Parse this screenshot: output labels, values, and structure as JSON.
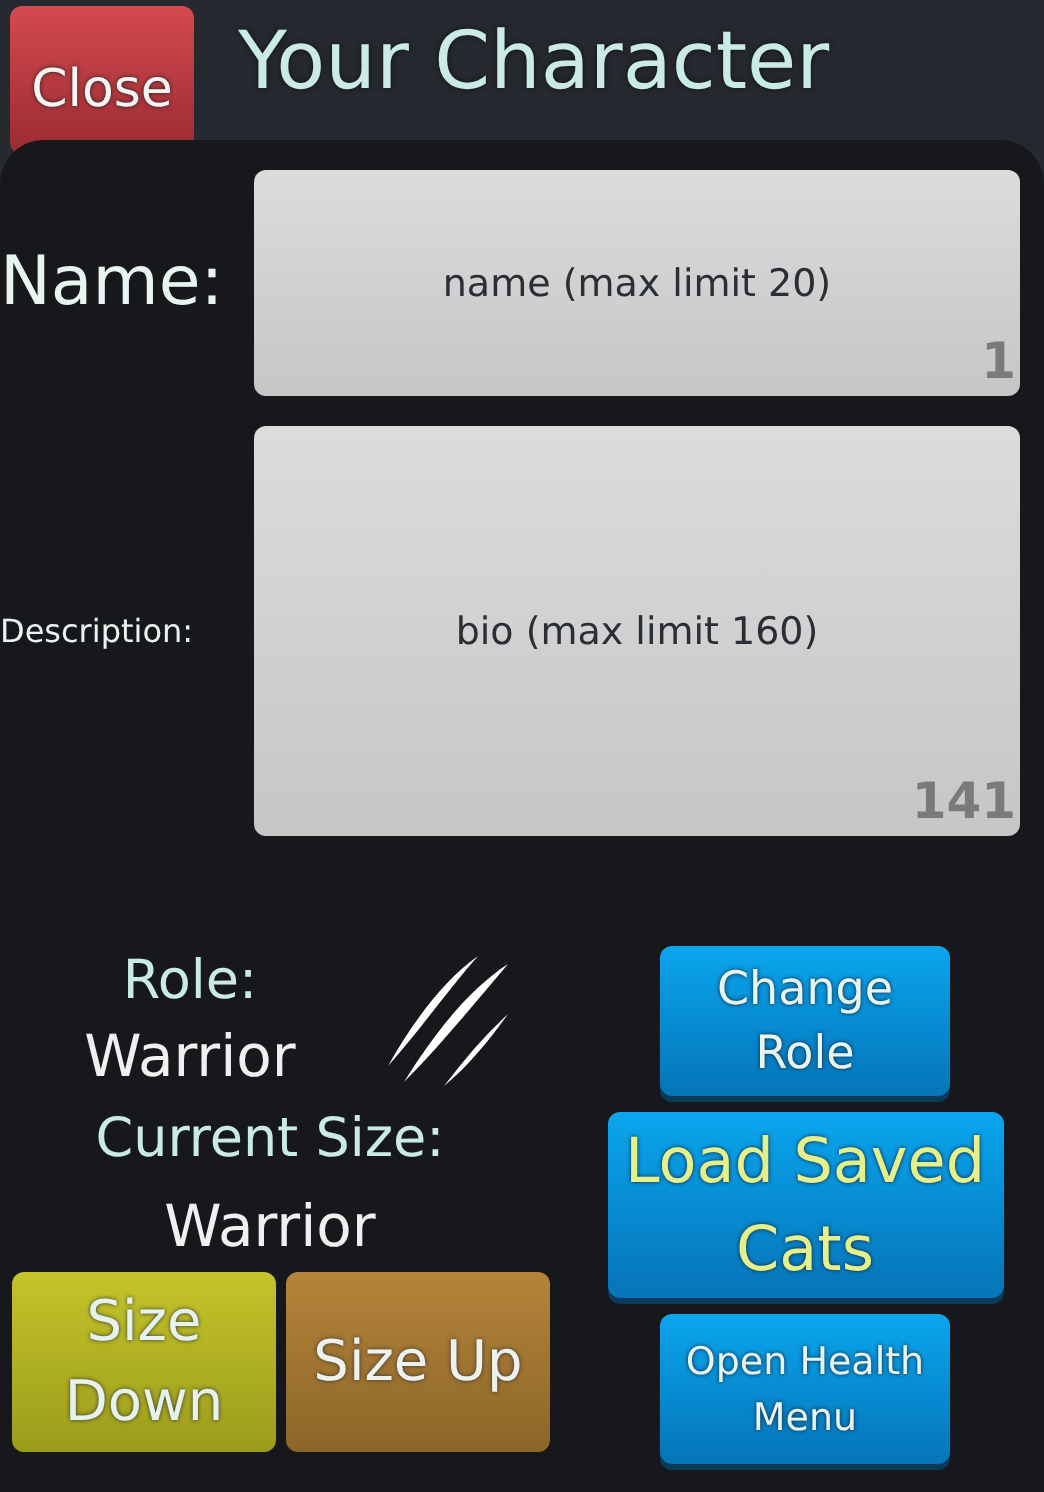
{
  "header": {
    "close_button": "Close",
    "title": "Your Character"
  },
  "fields": [
    {
      "kind": "name",
      "label": "Name:",
      "placeholder": "name (max limit 20)",
      "counter": "1"
    },
    {
      "kind": "bio",
      "label": "Description:",
      "placeholder": "bio (max limit 160)",
      "counter": "141"
    }
  ],
  "role": {
    "label": "Role:",
    "value": "Warrior"
  },
  "size": {
    "label": "Current Size:",
    "value": "Warrior"
  },
  "size_buttons": [
    {
      "kind": "down",
      "label": "Size Down"
    },
    {
      "kind": "up",
      "label": "Size Up"
    }
  ],
  "action_buttons": [
    {
      "kind": "small",
      "label": "Change Role"
    },
    {
      "kind": "large",
      "label": "Load Saved Cats"
    },
    {
      "kind": "compact",
      "label": "Open Health Menu"
    }
  ]
}
